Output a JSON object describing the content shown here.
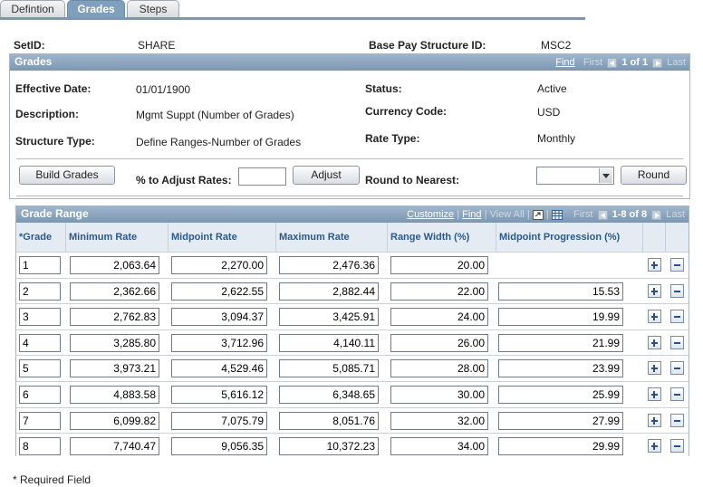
{
  "tabs": [
    {
      "label": "Defintion",
      "active": false
    },
    {
      "label": "Grades",
      "active": true
    },
    {
      "label": "Steps",
      "active": false
    }
  ],
  "header": {
    "setid_label": "SetID:",
    "setid_value": "SHARE",
    "bps_label": "Base Pay Structure ID:",
    "bps_value": "MSC2"
  },
  "grades_box": {
    "title": "Grades",
    "find": "Find",
    "first": "First",
    "count": "1 of 1",
    "last": "Last",
    "effective_date_label": "Effective Date:",
    "effective_date": "01/01/1900",
    "description_label": "Description:",
    "description": "Mgmt Suppt (Number of Grades)",
    "structure_type_label": "Structure Type:",
    "structure_type": "Define Ranges-Number of Grades",
    "status_label": "Status:",
    "status": "Active",
    "currency_label": "Currency Code:",
    "currency": "USD",
    "rate_type_label": "Rate Type:",
    "rate_type": "Monthly",
    "build_grades": "Build Grades",
    "pct_adjust_label": "% to Adjust Rates:",
    "pct_adjust_value": "",
    "adjust": "Adjust",
    "round_label": "Round to Nearest:",
    "round_value": "",
    "round_button": "Round"
  },
  "grade_range": {
    "title": "Grade Range",
    "customize": "Customize",
    "find": "Find",
    "view_all": "View All",
    "first": "First",
    "count": "1-8 of 8",
    "last": "Last",
    "columns": [
      "*Grade",
      "Minimum Rate",
      "Midpoint Rate",
      "Maximum Rate",
      "Range Width (%)",
      "Midpoint Progression (%)"
    ],
    "rows": [
      {
        "grade": "1",
        "min": "2,063.64",
        "mid": "2,270.00",
        "max": "2,476.36",
        "width": "20.00",
        "prog": ""
      },
      {
        "grade": "2",
        "min": "2,362.66",
        "mid": "2,622.55",
        "max": "2,882.44",
        "width": "22.00",
        "prog": "15.53"
      },
      {
        "grade": "3",
        "min": "2,762.83",
        "mid": "3,094.37",
        "max": "3,425.91",
        "width": "24.00",
        "prog": "19.99"
      },
      {
        "grade": "4",
        "min": "3,285.80",
        "mid": "3,712.96",
        "max": "4,140.11",
        "width": "26.00",
        "prog": "21.99"
      },
      {
        "grade": "5",
        "min": "3,973.21",
        "mid": "4,529.46",
        "max": "5,085.71",
        "width": "28.00",
        "prog": "23.99"
      },
      {
        "grade": "6",
        "min": "4,883.58",
        "mid": "5,616.12",
        "max": "6,348.65",
        "width": "30.00",
        "prog": "25.99"
      },
      {
        "grade": "7",
        "min": "6,099.82",
        "mid": "7,075.79",
        "max": "8,051.76",
        "width": "32.00",
        "prog": "27.99"
      },
      {
        "grade": "8",
        "min": "7,740.47",
        "mid": "9,056.35",
        "max": "10,372.23",
        "width": "34.00",
        "prog": "29.99"
      }
    ]
  },
  "footer": {
    "required_note": "* Required Field"
  },
  "icons": {
    "zoom": "zoom-grid-icon",
    "download": "download-grid-icon",
    "add_row": "plus-icon",
    "delete_row": "minus-icon"
  },
  "colors": {
    "bar": "#7c97b2",
    "header_text": "#2a5a8c",
    "column_header_bg": "#e4ebf2"
  }
}
